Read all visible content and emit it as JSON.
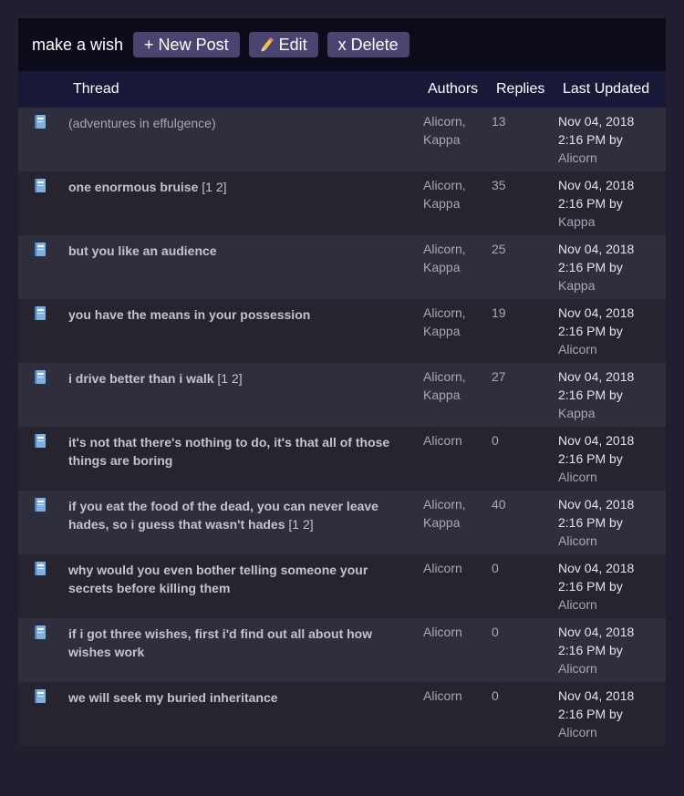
{
  "toolbar": {
    "title": "make a wish",
    "new_post": "+ New Post",
    "edit": "Edit",
    "delete": "x Delete"
  },
  "columns": {
    "thread": "Thread",
    "authors": "Authors",
    "replies": "Replies",
    "last_updated": "Last Updated"
  },
  "threads": [
    {
      "title": "(adventures in effulgence)",
      "pages": "",
      "authors_line1": "Alicorn,",
      "authors_line2": "Kappa",
      "replies": "13",
      "date": "Nov 04, 2018",
      "time": "2:16 PM by",
      "user": "Alicorn"
    },
    {
      "title": "one enormous bruise",
      "pages": "[1 2]",
      "authors_line1": "Alicorn,",
      "authors_line2": "Kappa",
      "replies": "35",
      "date": "Nov 04, 2018",
      "time": "2:16 PM by",
      "user": "Kappa"
    },
    {
      "title": "but you like an audience",
      "pages": "",
      "authors_line1": "Alicorn,",
      "authors_line2": "Kappa",
      "replies": "25",
      "date": "Nov 04, 2018",
      "time": "2:16 PM by",
      "user": "Kappa"
    },
    {
      "title": "you have the means in your possession",
      "pages": "",
      "authors_line1": "Alicorn,",
      "authors_line2": "Kappa",
      "replies": "19",
      "date": "Nov 04, 2018",
      "time": "2:16 PM by",
      "user": "Alicorn"
    },
    {
      "title": "i drive better than i walk",
      "pages": "[1 2]",
      "authors_line1": "Alicorn,",
      "authors_line2": "Kappa",
      "replies": "27",
      "date": "Nov 04, 2018",
      "time": "2:16 PM by",
      "user": "Kappa"
    },
    {
      "title": "it's not that there's nothing to do, it's that all of those things are boring",
      "pages": "",
      "authors_line1": "Alicorn",
      "authors_line2": "",
      "replies": "0",
      "date": "Nov 04, 2018",
      "time": "2:16 PM by",
      "user": "Alicorn"
    },
    {
      "title": "if you eat the food of the dead, you can never leave hades, so i guess that wasn't hades",
      "pages": "[1 2]",
      "authors_line1": "Alicorn,",
      "authors_line2": "Kappa",
      "replies": "40",
      "date": "Nov 04, 2018",
      "time": "2:16 PM by",
      "user": "Alicorn"
    },
    {
      "title": "why would you even bother telling someone your secrets before killing them",
      "pages": "",
      "authors_line1": "Alicorn",
      "authors_line2": "",
      "replies": "0",
      "date": "Nov 04, 2018",
      "time": "2:16 PM by",
      "user": "Alicorn"
    },
    {
      "title": "if i got three wishes, first i'd find out all about how wishes work",
      "pages": "",
      "authors_line1": "Alicorn",
      "authors_line2": "",
      "replies": "0",
      "date": "Nov 04, 2018",
      "time": "2:16 PM by",
      "user": "Alicorn"
    },
    {
      "title": "we will seek my buried inheritance",
      "pages": "",
      "authors_line1": "Alicorn",
      "authors_line2": "",
      "replies": "0",
      "date": "Nov 04, 2018",
      "time": "2:16 PM by",
      "user": "Alicorn"
    }
  ],
  "icons": {
    "thread": "book-icon",
    "edit": "pencil-icon"
  },
  "colors": {
    "background": "#211f2f",
    "toolbar": "#0c0b1a",
    "header": "#181938",
    "button": "#4a4570",
    "row_odd": "#2f2e3c",
    "row_even": "#25242f",
    "book_icon": "#7fb0e0"
  }
}
